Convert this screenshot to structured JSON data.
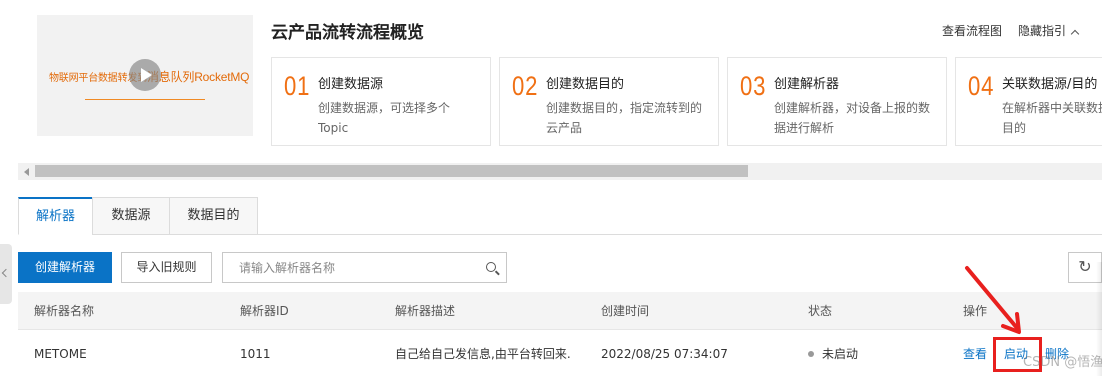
{
  "guide": {
    "video_caption_a": "物联网平台数据转发到",
    "video_caption_b": "消息队列RocketMQ",
    "title": "云产品流转流程概览",
    "view_flowchart": "查看流程图",
    "hide_guide": "隐藏指引",
    "steps": [
      {
        "num": "01",
        "title": "创建数据源",
        "desc1": "创建数据源，可选择多个",
        "desc2": "Topic"
      },
      {
        "num": "02",
        "title": "创建数据目的",
        "desc1": "创建数据目的，指定流转到的",
        "desc2": "云产品"
      },
      {
        "num": "03",
        "title": "创建解析器",
        "desc1": "创建解析器，对设备上报的数",
        "desc2": "据进行解析"
      },
      {
        "num": "04",
        "title": "关联数据源/目的",
        "desc1": "在解析器中关联数据源",
        "desc2": "目的"
      }
    ]
  },
  "tabs": [
    {
      "label": "解析器",
      "active": true
    },
    {
      "label": "数据源",
      "active": false
    },
    {
      "label": "数据目的",
      "active": false
    }
  ],
  "toolbar": {
    "create_label": "创建解析器",
    "import_label": "导入旧规则",
    "search_placeholder": "请输入解析器名称"
  },
  "table": {
    "headers": [
      "解析器名称",
      "解析器ID",
      "解析器描述",
      "创建时间",
      "状态",
      "操作"
    ],
    "rows": [
      {
        "name": "METOME",
        "id": "1011",
        "desc": "自己给自己发信息,由平台转回来.",
        "created": "2022/08/25 07:34:07",
        "status": "未启动",
        "actions": [
          "查看",
          "启动",
          "删除"
        ]
      }
    ]
  },
  "watermark": "CSDN @悟渔",
  "colors": {
    "primary": "#0a73c6",
    "step_number": "#f07014",
    "annotation": "#e8201e"
  }
}
